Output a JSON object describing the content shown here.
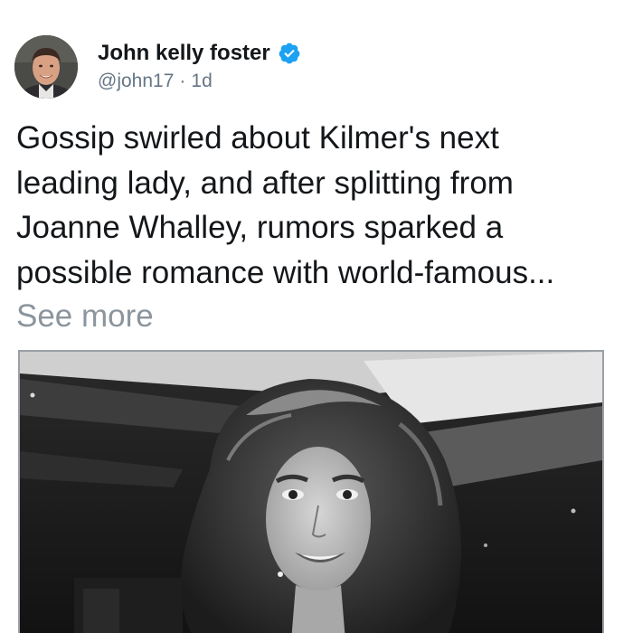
{
  "author": {
    "display_name": "John kelly foster",
    "handle": "@john17",
    "separator": "·",
    "timestamp": "1d",
    "verified_icon": "verified-badge-icon",
    "verified_color": "#1da1f2"
  },
  "post": {
    "text": "Gossip swirled about Kilmer's next\nleading lady, and after splitting from\nJoanne Whalley, rumors sparked a\npossible romance with world-famous...",
    "see_more_label": "See more"
  },
  "media": {
    "type": "photo",
    "style": "black-and-white"
  }
}
